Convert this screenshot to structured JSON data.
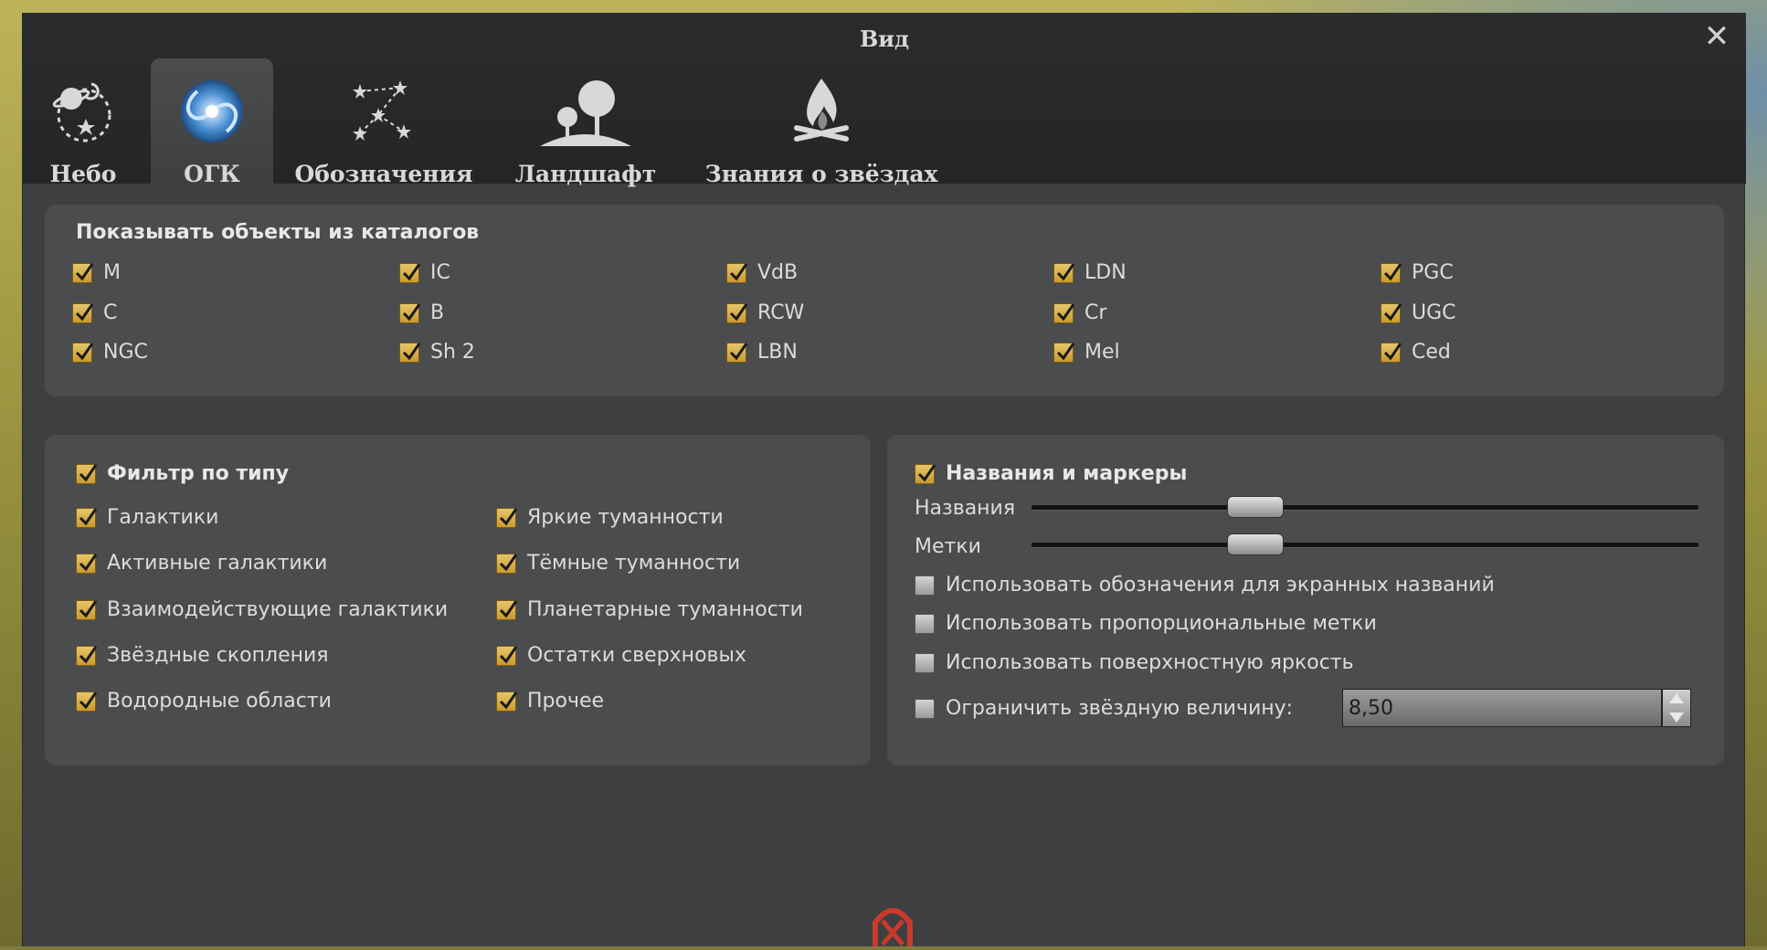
{
  "dialog": {
    "title": "Вид",
    "close_glyph": "✕"
  },
  "tabs": [
    {
      "label": "Небо",
      "icon": "sky-planets-icon",
      "active": false
    },
    {
      "label": "ОГК",
      "icon": "galaxy-icon",
      "active": true
    },
    {
      "label": "Обозначения",
      "icon": "constellation-icon",
      "active": false
    },
    {
      "label": "Ландшафт",
      "icon": "landscape-trees-icon",
      "active": false
    },
    {
      "label": "Знания о звёздах",
      "icon": "campfire-icon",
      "active": false
    }
  ],
  "catalogs": {
    "title": "Показывать объекты из каталогов",
    "items": [
      "M",
      "IC",
      "VdB",
      "LDN",
      "PGC",
      "C",
      "B",
      "RCW",
      "Cr",
      "UGC",
      "NGC",
      "Sh 2",
      "LBN",
      "Mel",
      "Ced"
    ],
    "all_checked": true
  },
  "type_filter": {
    "title": "Фильтр по типу",
    "enabled": true,
    "left": [
      "Галактики",
      "Активные галактики",
      "Взаимодействующие галактики",
      "Звёздные скопления",
      "Водородные области"
    ],
    "right": [
      "Яркие туманности",
      "Тёмные туманности",
      "Планетарные туманности",
      "Остатки сверхновых",
      "Прочее"
    ]
  },
  "labels_markers": {
    "title": "Названия и маркеры",
    "enabled": true,
    "names_label": "Названия",
    "marks_label": "Метки",
    "names_slider_fraction": 0.32,
    "marks_slider_fraction": 0.32,
    "options": [
      {
        "label": "Использовать обозначения для экранных названий",
        "checked": false
      },
      {
        "label": "Использовать пропорциональные метки",
        "checked": false
      },
      {
        "label": "Использовать поверхностную яркость",
        "checked": false
      }
    ],
    "limit_magnitude": {
      "label": "Ограничить звёздную величину:",
      "checked": false,
      "value": "8,50"
    }
  },
  "colors": {
    "checkbox_on": "#d9b24a",
    "panel": "#4a4c4e",
    "dialog": "#3d3f41",
    "header": "#262728"
  }
}
